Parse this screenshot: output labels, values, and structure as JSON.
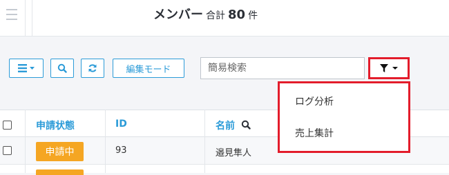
{
  "header": {
    "title": "メンバー",
    "total_label": "合計",
    "total_count": "80",
    "total_unit": "件"
  },
  "toolbar": {
    "menu_icon": "list-icon",
    "search_icon": "search-icon",
    "refresh_icon": "refresh-icon",
    "edit_mode_label": "編集モード",
    "search_placeholder": "簡易検索",
    "filter_icon": "filter-icon"
  },
  "filter_menu": {
    "items": [
      {
        "label": "ログ分析"
      },
      {
        "label": "売上集計"
      }
    ]
  },
  "table": {
    "columns": [
      "申請状態",
      "ID",
      "名前"
    ],
    "rows": [
      {
        "status": "申請中",
        "id": "93",
        "name": "邉見隼人"
      }
    ]
  },
  "colors": {
    "accent": "#2b9bd8",
    "highlight": "#e31c2b",
    "badge": "#f5a623"
  }
}
